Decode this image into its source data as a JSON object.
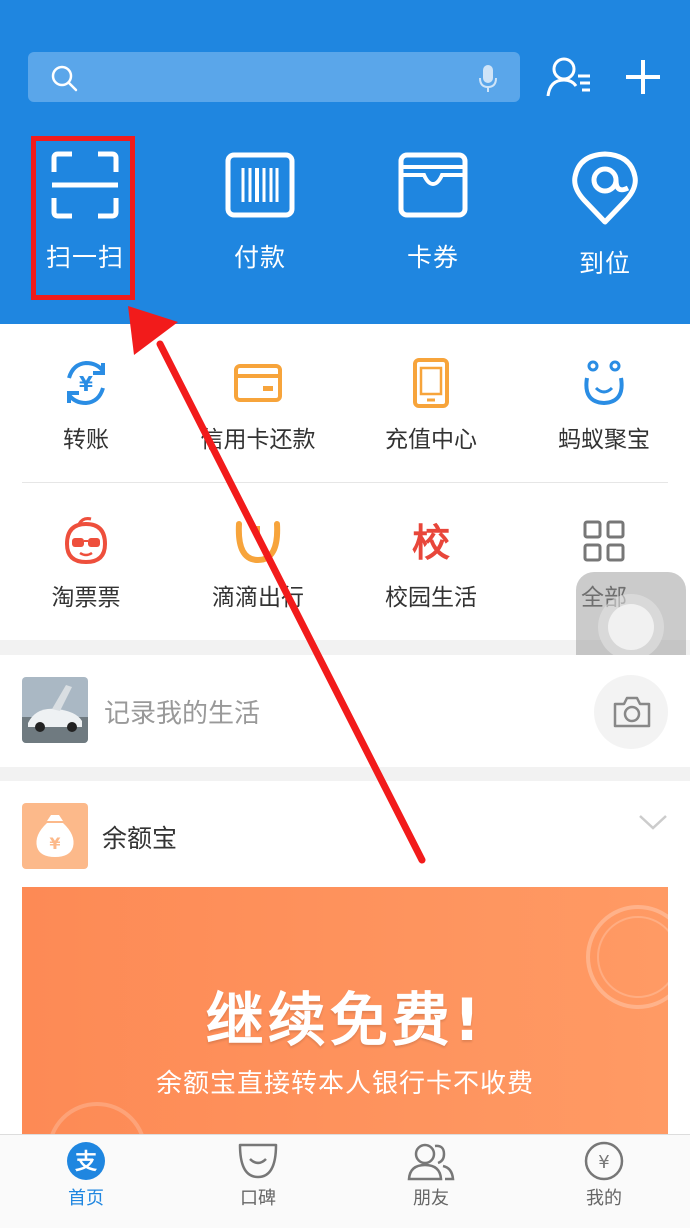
{
  "colors": {
    "brand": "#1f86e0",
    "annotation": "#f21b1b",
    "banner": "#fd8a55"
  },
  "search": {
    "placeholder": ""
  },
  "quick_actions": [
    {
      "label": "扫一扫",
      "icon": "scan-icon"
    },
    {
      "label": "付款",
      "icon": "barcode-icon"
    },
    {
      "label": "卡券",
      "icon": "card-wallet-icon"
    },
    {
      "label": "到位",
      "icon": "location-pin-icon"
    }
  ],
  "services_row1": [
    {
      "label": "转账",
      "icon": "transfer-icon"
    },
    {
      "label": "信用卡还款",
      "icon": "credit-card-icon"
    },
    {
      "label": "充值中心",
      "icon": "phone-recharge-icon"
    },
    {
      "label": "蚂蚁聚宝",
      "icon": "ant-fortune-icon"
    }
  ],
  "services_row2": [
    {
      "label": "淘票票",
      "icon": "movie-ticket-icon"
    },
    {
      "label": "滴滴出行",
      "icon": "didi-icon"
    },
    {
      "label": "校园生活",
      "icon": "campus-icon",
      "glyph": "校"
    },
    {
      "label": "全部",
      "icon": "all-grid-icon"
    }
  ],
  "life": {
    "placeholder": "记录我的生活"
  },
  "yuebao": {
    "title": "余额宝",
    "banner_title": "继续免费!",
    "banner_subtitle": "余额宝直接转本人银行卡不收费"
  },
  "tabs": [
    {
      "label": "首页",
      "active": true,
      "glyph": "支"
    },
    {
      "label": "口碑",
      "active": false
    },
    {
      "label": "朋友",
      "active": false
    },
    {
      "label": "我的",
      "active": false,
      "glyph": "¥"
    }
  ]
}
